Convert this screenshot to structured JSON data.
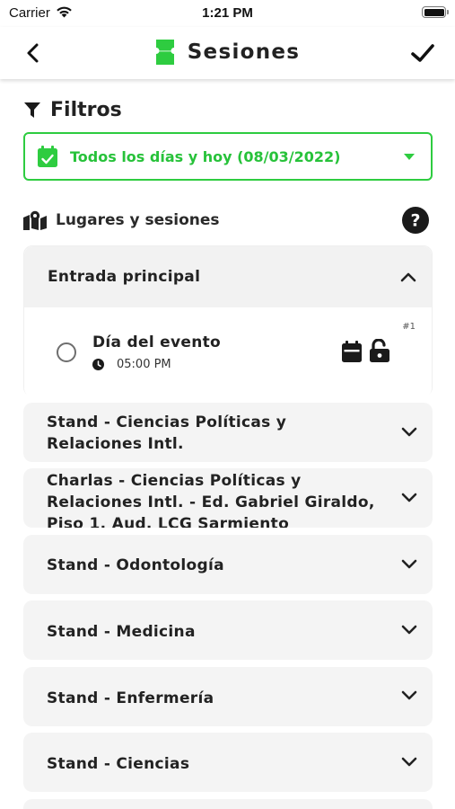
{
  "status_bar": {
    "carrier": "Carrier",
    "time": "1:21 PM"
  },
  "nav": {
    "title": "Sesiones",
    "back_icon": "chevron-left-icon",
    "confirm_icon": "check-icon",
    "title_icon": "ticket-icon"
  },
  "filters": {
    "title": "Filtros",
    "date_select": {
      "value": "Todos los días y hoy (08/03/2022)"
    }
  },
  "places": {
    "label": "Lugares y sesiones"
  },
  "colors": {
    "accent": "#2ecc40",
    "accent_text": "#27c23a",
    "card_bg": "#f4f4f4"
  },
  "sections": [
    {
      "title": "Entrada principal",
      "expanded": true,
      "sessions": [
        {
          "name": "Día del evento",
          "time": "05:00 PM",
          "number": "#1"
        }
      ]
    },
    {
      "title": "Stand - Ciencias Políticas y Relaciones Intl.",
      "expanded": false
    },
    {
      "title": "Charlas - Ciencias Políticas y Relaciones Intl. - Ed. Gabriel Giraldo, Piso 1. Aud. LCG Sarmiento",
      "expanded": false
    },
    {
      "title": "Stand - Odontología",
      "expanded": false
    },
    {
      "title": "Stand - Medicina",
      "expanded": false
    },
    {
      "title": "Stand - Enfermería",
      "expanded": false
    },
    {
      "title": "Stand - Ciencias",
      "expanded": false
    }
  ]
}
